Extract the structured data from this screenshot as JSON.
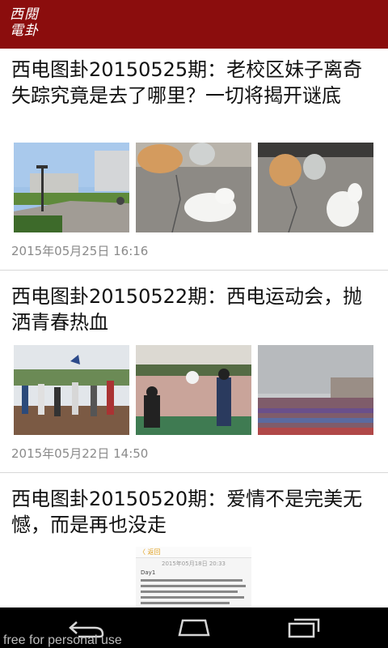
{
  "app": {
    "logo_line1": "西閱",
    "logo_line2": "電卦"
  },
  "articles": [
    {
      "title": "西电图卦20150525期：老校区妹子离奇失踪究竟是去了哪里？一切将揭开谜底",
      "date": "2015年05月25日 16:16",
      "thumbnails": [
        "campus-road-photo",
        "cats-photo",
        "cats-photo-2"
      ]
    },
    {
      "title": "西电图卦20150522期：西电运动会，抛洒青春热血",
      "date": "2015年05月22日 14:50",
      "thumbnails": [
        "sports-meet-crowd-photo",
        "sports-meet-track-photo",
        "stadium-photo"
      ]
    },
    {
      "title": "西电图卦20150520期：爱情不是完美无憾，而是再也没走",
      "thumbnails": [
        "chat-screenshot"
      ]
    }
  ],
  "screenshot_thumb": {
    "back": "〈 返回",
    "time": "2015年05月18日 20:33",
    "heading": "Day1"
  },
  "navbar": {
    "icons": [
      "back-icon",
      "home-icon",
      "recent-apps-icon"
    ]
  },
  "watermark": "free for personal use",
  "colors": {
    "appbar": "#8b0d0d",
    "navbar": "#000000",
    "date_text": "#8a8a8a"
  }
}
